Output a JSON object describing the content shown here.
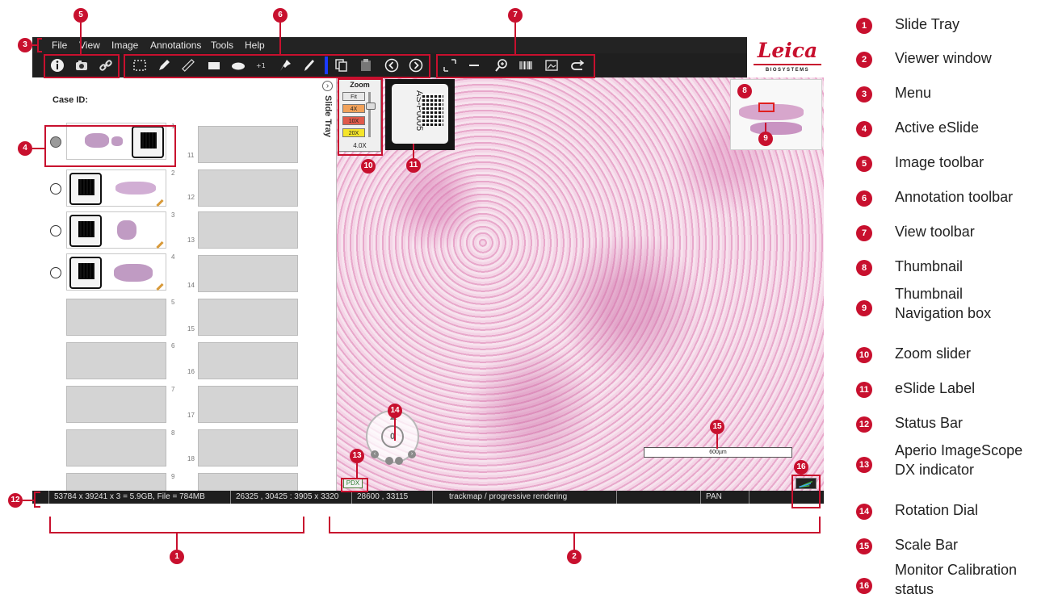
{
  "menu": [
    "File",
    "View",
    "Image",
    "Annotations",
    "Tools",
    "Help"
  ],
  "logo": {
    "brand": "Leica",
    "sub": "BIOSYSTEMS",
    "color": "#c8102e"
  },
  "tray": {
    "case_label": "Case ID:",
    "tab_label": "Slide Tray",
    "slot_numbers": [
      "1",
      "2",
      "3",
      "4",
      "5",
      "6",
      "7",
      "8",
      "9",
      "11",
      "12",
      "13",
      "14",
      "15",
      "16",
      "17",
      "18"
    ]
  },
  "viewer": {
    "zoom_title": "Zoom",
    "zoom_levels": [
      "Fit",
      "4X",
      "10X",
      "20X"
    ],
    "zoom_current": "4.0X",
    "label_text": "AS-P0005",
    "pdx_label": "PDX",
    "scale_label": "600µm",
    "dial_value": "0"
  },
  "status": {
    "dims": "53784 x 39241 x 3 = 5.9GB, File = 784MB",
    "region": "26325 , 30425 : 3905 x 3320",
    "coords": "28600 , 33115",
    "mode": "trackmap / progressive rendering",
    "tool": "PAN"
  },
  "callouts": [
    "1",
    "2",
    "3",
    "4",
    "5",
    "6",
    "7",
    "8",
    "9",
    "10",
    "11",
    "12",
    "13",
    "14",
    "15",
    "16"
  ],
  "legend": [
    {
      "num": "1",
      "text": "Slide Tray"
    },
    {
      "num": "2",
      "text": "Viewer window"
    },
    {
      "num": "3",
      "text": "Menu"
    },
    {
      "num": "4",
      "text": "Active eSlide"
    },
    {
      "num": "5",
      "text": "Image toolbar"
    },
    {
      "num": "6",
      "text": "Annotation toolbar"
    },
    {
      "num": "7",
      "text": "View toolbar"
    },
    {
      "num": "8",
      "text": "Thumbnail"
    },
    {
      "num": "9",
      "text": "Thumbnail",
      "text2": "Navigation box"
    },
    {
      "num": "10",
      "text": "Zoom slider"
    },
    {
      "num": "11",
      "text": "eSlide Label"
    },
    {
      "num": "12",
      "text": "Status Bar"
    },
    {
      "num": "13",
      "text": "Aperio ImageScope",
      "text2": "DX indicator"
    },
    {
      "num": "14",
      "text": "Rotation Dial"
    },
    {
      "num": "15",
      "text": "Scale Bar"
    },
    {
      "num": "16",
      "text": "Monitor Calibration",
      "text2": "status"
    }
  ],
  "accent_color": "#c8102e"
}
